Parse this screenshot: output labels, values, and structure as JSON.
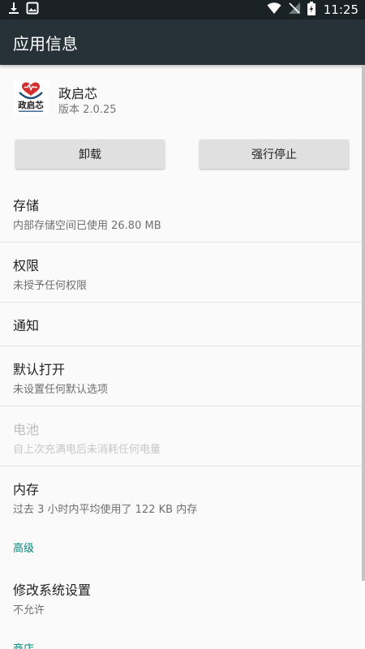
{
  "status_bar": {
    "time": "11:25",
    "icons": [
      "download-icon",
      "image-icon",
      "wifi-icon",
      "no-signal-icon",
      "battery-charging-icon"
    ]
  },
  "app_bar": {
    "title": "应用信息"
  },
  "app": {
    "name": "政启芯",
    "version": "版本 2.0.25",
    "icon": "app-logo",
    "logo_text": "政启芯"
  },
  "buttons": {
    "uninstall": "卸载",
    "force_stop": "强行停止"
  },
  "items": {
    "storage": {
      "title": "存储",
      "subtitle": "内部存储空间已使用 26.80 MB"
    },
    "permissions": {
      "title": "权限",
      "subtitle": "未授予任何权限"
    },
    "notifications": {
      "title": "通知"
    },
    "open_by_default": {
      "title": "默认打开",
      "subtitle": "未设置任何默认选项"
    },
    "battery": {
      "title": "电池",
      "subtitle": "自上次充满电后未消耗任何电量"
    },
    "memory": {
      "title": "内存",
      "subtitle": "过去 3 小时内平均使用了 122 KB 内存"
    },
    "advanced_header": "高级",
    "modify_system": {
      "title": "修改系统设置",
      "subtitle": "不允许"
    },
    "store_header": "商店"
  },
  "colors": {
    "app_bar": "#263238",
    "status_bar": "#1a2226",
    "accent": "#00897b"
  }
}
